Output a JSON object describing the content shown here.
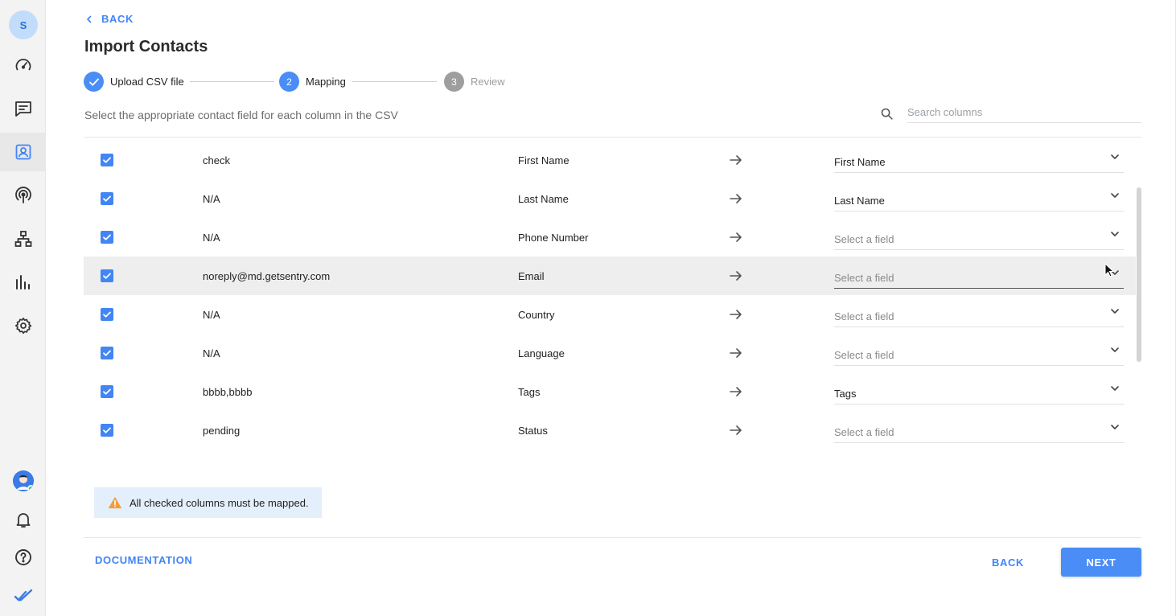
{
  "sidebar": {
    "avatar_letter": "S",
    "items": [
      {
        "name": "dashboard-icon"
      },
      {
        "name": "messages-icon"
      },
      {
        "name": "contacts-icon",
        "active": true
      },
      {
        "name": "broadcast-icon"
      },
      {
        "name": "workflows-icon"
      },
      {
        "name": "reports-icon"
      },
      {
        "name": "settings-icon"
      }
    ],
    "bottom": [
      "user-avatar",
      "bell-icon",
      "help-icon",
      "logo-icon"
    ]
  },
  "header": {
    "back_label": "BACK",
    "title": "Import Contacts"
  },
  "stepper": {
    "steps": [
      {
        "label": "Upload CSV file",
        "state": "done"
      },
      {
        "number": "2",
        "label": "Mapping",
        "state": "active"
      },
      {
        "number": "3",
        "label": "Review",
        "state": "pending"
      }
    ]
  },
  "instruction": "Select the appropriate contact field for each column in the CSV",
  "search": {
    "placeholder": "Search columns",
    "value": ""
  },
  "rows": [
    {
      "checked": true,
      "csv_value": "check",
      "column": "First Name",
      "field": "First Name",
      "placeholder": false
    },
    {
      "checked": true,
      "csv_value": "N/A",
      "column": "Last Name",
      "field": "Last Name",
      "placeholder": false
    },
    {
      "checked": true,
      "csv_value": "N/A",
      "column": "Phone Number",
      "field": "Select a field",
      "placeholder": true
    },
    {
      "checked": true,
      "csv_value": "noreply@md.getsentry.com",
      "column": "Email",
      "field": "Select a field",
      "placeholder": true,
      "hover": true
    },
    {
      "checked": true,
      "csv_value": "N/A",
      "column": "Country",
      "field": "Select a field",
      "placeholder": true
    },
    {
      "checked": true,
      "csv_value": "N/A",
      "column": "Language",
      "field": "Select a field",
      "placeholder": true
    },
    {
      "checked": true,
      "csv_value": "bbbb,bbbb",
      "column": "Tags",
      "field": "Tags",
      "placeholder": false
    },
    {
      "checked": true,
      "csv_value": "pending",
      "column": "Status",
      "field": "Select a field",
      "placeholder": true
    }
  ],
  "warning": "All checked columns must be mapped.",
  "footer": {
    "documentation": "DOCUMENTATION",
    "back": "BACK",
    "next": "NEXT"
  },
  "colors": {
    "accent": "#4285f4",
    "done": "#4a8df6",
    "pending": "#9e9e9e",
    "warning_bg": "#e3effb",
    "warning_icon": "#f29d38"
  }
}
